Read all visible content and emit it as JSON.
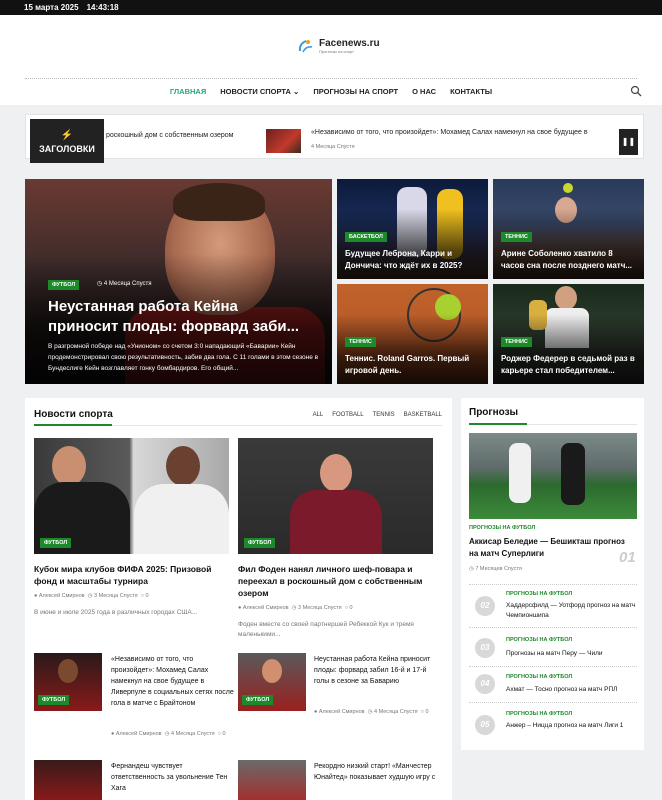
{
  "topbar": {
    "date": "15 марта 2025",
    "time": "14:43:18"
  },
  "logo": {
    "name": "Facenews.ru",
    "tagline": "Прогнозы на спорт"
  },
  "nav": [
    "ГЛАВНАЯ",
    "НОВОСТИ СПОРТА",
    "ПРОГНОЗЫ НА СПОРТ",
    "О НАС",
    "КОНТАКТЫ"
  ],
  "ticker": {
    "label": "ЗАГОЛОВКИ",
    "first_text": "роскошный дом с собственным озером",
    "title": "«Независимо от того, что произойдет»: Мохамед Салах намекнул на свое будущее в",
    "meta": "4 Месяца Спустя"
  },
  "hero": {
    "tag": "ФУТБОЛ",
    "meta": "4 Месяца Спустя",
    "title": "Неустанная работа Кейна приносит плоды: форвард заби...",
    "excerpt": "В разгромной победе над «Унионом» со счетом 3:0 нападающий «Баварии» Кейн продемонстрировал свою результативность, забив два гола. С 11 голами в этом сезоне в Бундеслиге Кейн возглавляет гонку бомбардиров. Его общий..."
  },
  "cards": [
    {
      "tag": "БАСКЕТБОЛ",
      "title": "Будущее Леброна, Карри и Дончича: что ждёт их в 2025?"
    },
    {
      "tag": "ТЕННИС",
      "title": "Арине Соболенко хватило 8 часов сна после позднего матч..."
    },
    {
      "tag": "ТЕННИС",
      "title": "Теннис. Roland Garros. Первый игровой день."
    },
    {
      "tag": "ТЕННИС",
      "title": "Роджер Федерер в седьмой раз в карьере стал победителем..."
    }
  ],
  "news": {
    "title": "Новости спорта",
    "filters": [
      "ALL",
      "FOOTBALL",
      "TENNIS",
      "BASKETBALL"
    ],
    "big": [
      {
        "tag": "ФУТБОЛ",
        "title": "Кубок мира клубов ФИФА 2025: Призовой фонд и масштабы турнира",
        "author": "Алексей Смирнов",
        "time": "3 Месяца Спустя",
        "comments": "0",
        "excerpt": "В июне и июле 2025 года в различных городах США..."
      },
      {
        "tag": "ФУТБОЛ",
        "title": "Фил Фоден нанял личного шеф-повара и переехал в роскошный дом с собственным озером",
        "author": "Алексей Смирнов",
        "time": "3 Месяца Спустя",
        "comments": "0",
        "excerpt": "Фоден вместе со своей партнершей Ребеккой Кук и тремя маленькими..."
      }
    ],
    "small": [
      {
        "tag": "ФУТБОЛ",
        "title": "«Независимо от того, что произойдет»: Мохамед Салах намекнул на свое будущее в Ливерпуле в социальных сетях после гола в матче с Брайтоном",
        "author": "Алексей Смирнов",
        "time": "4 Месяца Спустя",
        "comments": "0"
      },
      {
        "tag": "ФУТБОЛ",
        "title": "Неустанная работа Кейна приносит плоды: форвард забил 16-й и 17-й голы в сезоне за Баварию",
        "author": "Алексей Смирнов",
        "time": "4 Месяца Спустя",
        "comments": "0"
      },
      {
        "title": "Фернандеш чувствует ответственность за увольнение Тен Хага"
      },
      {
        "title": "Рекордно низкий старт! «Манчестер Юнайтед» показывает худшую игру с"
      }
    ]
  },
  "forecasts": {
    "title": "Прогнозы",
    "main": {
      "category": "ПРОГНОЗЫ НА ФУТБОЛ",
      "title": "Аккисар Беледие — Бешикташ прогноз на матч Суперлиги",
      "meta": "7 Месяцев Спустя",
      "num": "01"
    },
    "items": [
      {
        "num": "02",
        "category": "ПРОГНОЗЫ НА ФУТБОЛ",
        "title": "Хаддерсфилд — Уотфорд прогноз на матч Чемпионшипа"
      },
      {
        "num": "03",
        "category": "ПРОГНОЗЫ НА ФУТБОЛ",
        "title": "Прогнозы на матч Перу — Чили"
      },
      {
        "num": "04",
        "category": "ПРОГНОЗЫ НА ФУТБОЛ",
        "title": "Ахмат — Тосно прогноз на матч РПЛ"
      },
      {
        "num": "05",
        "category": "ПРОГНОЗЫ НА ФУТБОЛ",
        "title": "Анжер – Ницца прогноз на матч Лиги 1"
      }
    ]
  },
  "colors": {
    "accent": "#1c8a2a",
    "dark": "#222222",
    "topbar": "#111111"
  }
}
